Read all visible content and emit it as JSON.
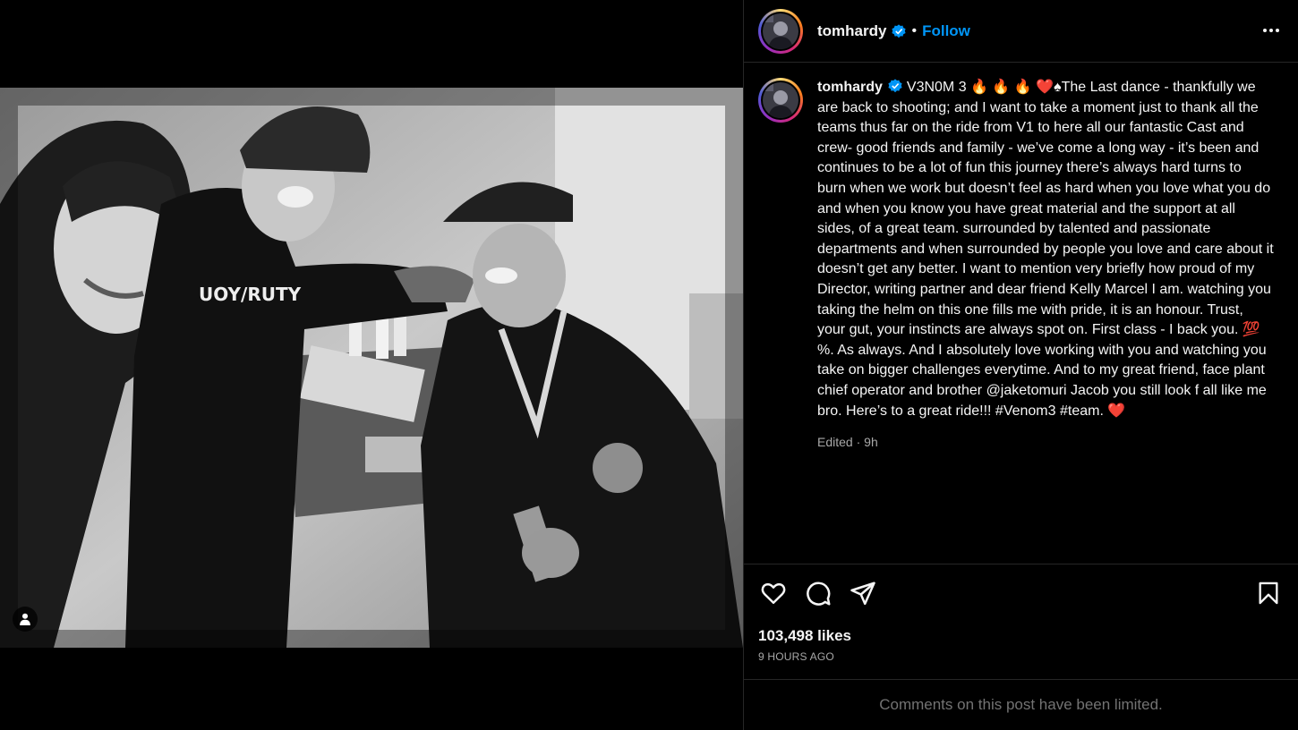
{
  "post": {
    "username": "tomhardy",
    "verified": true,
    "follow_label": "Follow",
    "dot": "•",
    "more_label": "More options",
    "caption_prefix": "V3N0M 3 🔥 🔥 🔥 ❤️♠",
    "caption": "The Last dance - thankfully we are back to shooting; and I want to take a moment just to thank all the teams thus far on the ride from V1 to here all our fantastic Cast and crew- good friends and family - we’ve come a long way - it’s been and continues to be a lot of fun this journey there’s always hard turns to burn when we work but doesn’t feel as hard when you love what you do and when you know you have great material and the support at all sides, of a great team. surrounded by talented and passionate departments and when surrounded by people you love and care about it doesn’t get any better. I want to mention very briefly how proud of my Director, writing partner and dear friend Kelly Marcel I am. watching you taking the helm on this one fills me with pride, it is an honour. Trust, your gut, your instincts are always spot on. First class - I back you. 💯 %. As always. And I absolutely love working with you and watching you take on bigger challenges everytime. And to my great friend, face plant chief operator and brother @jaketomuri Jacob you still look f all like me bro. Here’s to a great ride!!! #Venom3 #team. ❤️",
    "edited_label": "Edited",
    "edited_sep": "·",
    "edited_age": "9h",
    "likes": "103,498 likes",
    "timestamp": "9 HOURS AGO",
    "comments_limited": "Comments on this post have been limited."
  },
  "icons": {
    "like": "heart-icon",
    "comment": "comment-icon",
    "share": "share-icon",
    "save": "bookmark-icon",
    "tag": "user-tag-icon",
    "verified": "verified-badge-icon"
  },
  "colors": {
    "background": "#000000",
    "text": "#f5f5f5",
    "muted": "#a8a8a8",
    "link": "#0095f6",
    "divider": "#262626",
    "verified": "#0095f6"
  }
}
